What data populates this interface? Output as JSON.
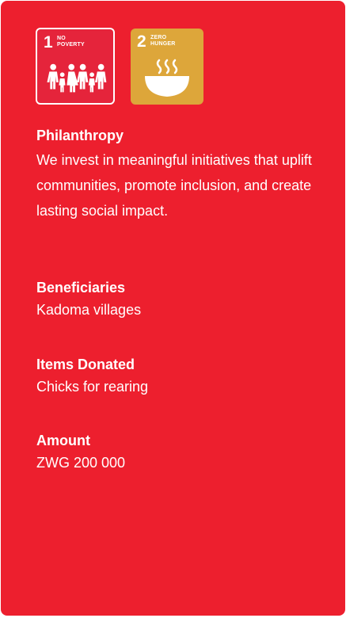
{
  "sdg_badges": [
    {
      "number": "1",
      "title_line1": "NO",
      "title_line2": "POVERTY",
      "color": "#e5243b",
      "icon": "family-icon"
    },
    {
      "number": "2",
      "title_line1": "ZERO",
      "title_line2": "HUNGER",
      "color": "#dda63a",
      "icon": "bowl-icon"
    }
  ],
  "card": {
    "background": "#ed1f2e"
  },
  "philanthropy": {
    "heading": "Philanthropy",
    "text": "We invest in meaningful initiatives that uplift communities, promote inclusion, and create lasting social impact."
  },
  "beneficiaries": {
    "heading": "Beneficiaries",
    "text": "Kadoma villages"
  },
  "items_donated": {
    "heading": "Items Donated",
    "text": "Chicks for rearing"
  },
  "amount": {
    "heading": "Amount",
    "text": "ZWG 200 000"
  }
}
